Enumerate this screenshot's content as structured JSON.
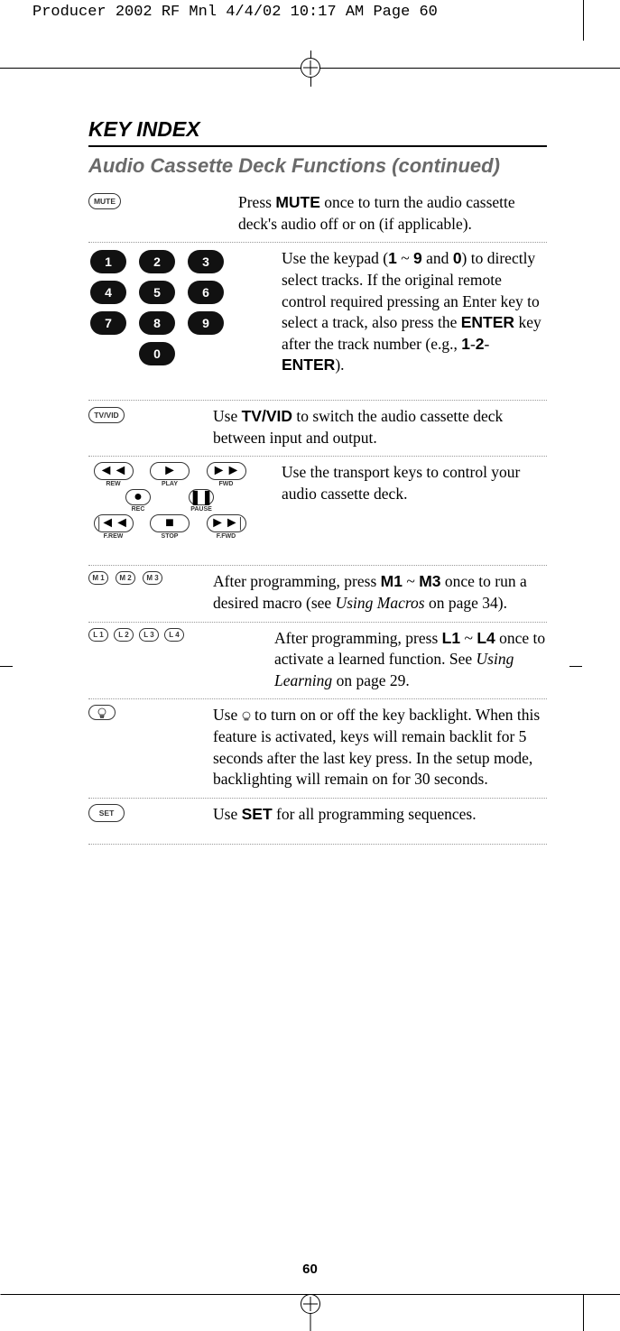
{
  "crop_header": "Producer 2002 RF Mnl  4/4/02  10:17 AM  Page 60",
  "title": "KEY INDEX",
  "subtitle": "Audio Cassette Deck Functions (continued)",
  "mute": {
    "label": "MUTE",
    "text_pre": "Press ",
    "text_bold": "MUTE",
    "text_post": " once to turn the audio cassette deck's audio off or on (if applicable)."
  },
  "keypad": {
    "keys": [
      "1",
      "2",
      "3",
      "4",
      "5",
      "6",
      "7",
      "8",
      "9",
      "0"
    ],
    "t1": "Use the keypad (",
    "b1": "1",
    "t2": " ~ ",
    "b2": "9",
    "t3": " and ",
    "b3": "0",
    "t4": ") to directly select tracks. If the original remote control required pressing an Enter key to select a track, also press the ",
    "b4": "ENTER",
    "t5": " key after the track number (e.g., ",
    "b5": "1",
    "t6": "-",
    "b6": "2",
    "t7": "-",
    "b7": "ENTER",
    "t8": ")."
  },
  "tvvid": {
    "label": "TV/VID",
    "t1": "Use ",
    "b1": "TV/VID",
    "t2": " to switch the audio cassette deck between input and output."
  },
  "transport": {
    "labels": {
      "rew": "REW",
      "play": "PLAY",
      "fwd": "FWD",
      "rec": "REC",
      "pause": "PAUSE",
      "frew": "F.REW",
      "stop": "STOP",
      "ffwd": "F.FWD"
    },
    "text": "Use the transport keys to control your audio cassette deck."
  },
  "macros": {
    "keys": [
      "M 1",
      "M 2",
      "M 3"
    ],
    "t1": "After programming, press ",
    "b1": "M1",
    "t2": " ~ ",
    "b2": "M3",
    "t3": " once to run a desired macro (see ",
    "i1": "Using Macros",
    "t4": " on page 34)."
  },
  "learn": {
    "keys": [
      "L 1",
      "L 2",
      "L 3",
      "L 4"
    ],
    "t1": "After programming, press ",
    "b1": "L1",
    "t2": " ~ ",
    "b2": "L4",
    "t3": " once to activate a learned function. See ",
    "i1": "Using Learning",
    "t4": " on page 29."
  },
  "light": {
    "t1": "Use ",
    "sym": "💡",
    "t2": " to turn on or off the key backlight. When this feature is activated, keys will remain backlit for 5 seconds after the last key press. In the setup mode, backlighting will remain on for 30 seconds."
  },
  "set": {
    "label": "SET",
    "t1": "Use ",
    "b1": "SET",
    "t2": " for all programming sequences."
  },
  "page_num": "60"
}
